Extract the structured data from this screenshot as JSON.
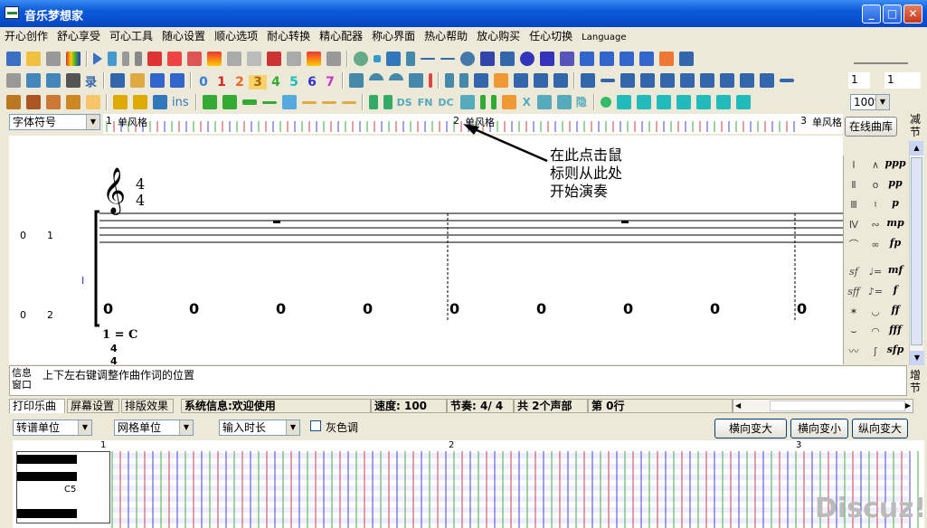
{
  "window": {
    "title": "音乐梦想家"
  },
  "menu": [
    "开心创作",
    "舒心享受",
    "可心工具",
    "随心设置",
    "顺心选项",
    "耐心转换",
    "精心配器",
    "称心界面",
    "热心帮助",
    "放心购买",
    "任心切换",
    "Language"
  ],
  "toolbar": {
    "zoom": "100%",
    "spin1": "1",
    "spin2": "1",
    "numbers": [
      "0",
      "1",
      "2",
      "3",
      "4",
      "5",
      "6",
      "7"
    ],
    "text_buttons": [
      "录",
      "ins",
      "DS",
      "FN",
      "DC",
      "X",
      "隐"
    ],
    "font_symbol": "字体符号",
    "online_library": "在线曲库",
    "decrease": "减节",
    "increase": "增节"
  },
  "ruler": {
    "measures": [
      "1",
      "2",
      "3"
    ],
    "style": "单风格"
  },
  "annotation": {
    "line1": "在此点击鼠",
    "line2": "标则从此处",
    "line3": "开始演奏"
  },
  "score": {
    "time_top": "4",
    "time_bottom": "4",
    "key": "1 = C",
    "cursor": "I",
    "row_labels": [
      {
        "a": "0",
        "b": "1"
      },
      {
        "a": "0",
        "b": "2"
      }
    ],
    "beat_nums": [
      "0",
      "0",
      "0",
      "0",
      "0",
      "0",
      "0",
      "0",
      "0"
    ],
    "key_ts_top": "4",
    "key_ts_bottom": "4"
  },
  "palette": {
    "roman": [
      "Ⅰ",
      "Ⅱ",
      "Ⅲ",
      "Ⅳ"
    ],
    "dynamics": [
      "ppp",
      "pp",
      "p",
      "mp",
      "fp",
      "mf",
      "f",
      "ff",
      "fff",
      "sfp"
    ],
    "misc": [
      "sf",
      "sff"
    ]
  },
  "info": {
    "label": "信息窗口",
    "text": "上下左右键调整作曲作词的位置"
  },
  "status": {
    "tabs": [
      "打印乐曲",
      "屏幕设置",
      "排版效果"
    ],
    "system": "系统信息:欢迎使用",
    "speed": "速度: 100",
    "beat": "节奏: 4/ 4",
    "voices": "共 2个声部",
    "row": "第 0行"
  },
  "bottom": {
    "transpose": "转谱单位",
    "grid": "网格单位",
    "input_len": "输入时长",
    "gray": "灰色调",
    "h_expand": "横向变大",
    "h_shrink": "横向变小",
    "v_expand": "纵向变大",
    "measures": [
      "1",
      "2",
      "3"
    ],
    "note_label": "C5"
  },
  "watermark": "Discuz!"
}
